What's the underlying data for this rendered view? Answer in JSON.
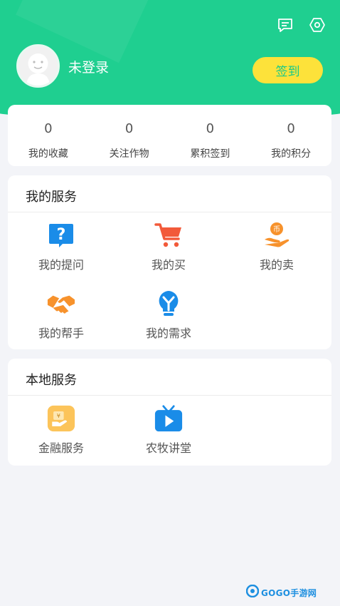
{
  "header": {
    "username": "未登录",
    "signin_label": "签到"
  },
  "stats": [
    {
      "value": "0",
      "label": "我的收藏"
    },
    {
      "value": "0",
      "label": "关注作物"
    },
    {
      "value": "0",
      "label": "累积签到"
    },
    {
      "value": "0",
      "label": "我的积分"
    }
  ],
  "my_services": {
    "title": "我的服务",
    "items": [
      {
        "label": "我的提问",
        "icon": "question-icon"
      },
      {
        "label": "我的买",
        "icon": "cart-icon"
      },
      {
        "label": "我的卖",
        "icon": "hand-coin-icon"
      },
      {
        "label": "我的帮手",
        "icon": "handshake-icon"
      },
      {
        "label": "我的需求",
        "icon": "bulb-icon"
      }
    ]
  },
  "local_services": {
    "title": "本地服务",
    "items": [
      {
        "label": "金融服务",
        "icon": "finance-icon"
      },
      {
        "label": "农牧讲堂",
        "icon": "tv-icon"
      }
    ]
  },
  "watermark": "GOGO手游网",
  "colors": {
    "header_green": "#1fcf90",
    "signin_yellow": "#fde23a",
    "question_blue": "#1a8ce8",
    "cart_red": "#f25a3a",
    "orange": "#f7922c"
  }
}
